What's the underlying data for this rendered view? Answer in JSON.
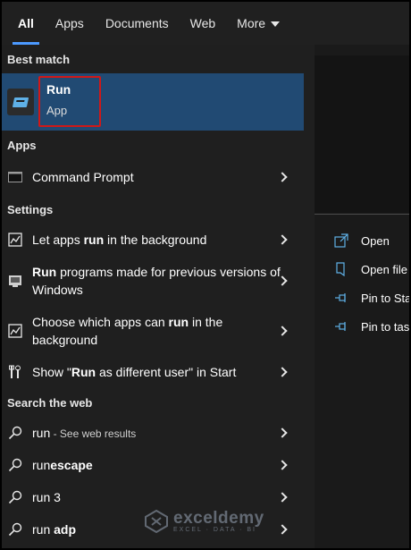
{
  "tabs": [
    {
      "label": "All",
      "active": true
    },
    {
      "label": "Apps"
    },
    {
      "label": "Documents"
    },
    {
      "label": "Web"
    },
    {
      "label": "More"
    }
  ],
  "best_match": {
    "header": "Best match",
    "title": "Run",
    "subtitle": "App",
    "icon": "run-app-icon",
    "highlight_color": "#d01818"
  },
  "apps": {
    "header": "Apps",
    "items": [
      {
        "label": "Command Prompt",
        "icon": "command-prompt-icon"
      }
    ]
  },
  "settings": {
    "header": "Settings",
    "items": [
      {
        "pre": "Let apps ",
        "bold": "run",
        "post": " in the background",
        "icon": "chart-settings-icon"
      },
      {
        "pre": "",
        "bold": "Run",
        "post": " programs made for previous versions of Windows",
        "icon": "compat-settings-icon"
      },
      {
        "pre": "Choose which apps can ",
        "bold": "run",
        "post": " in the background",
        "icon": "chart-settings-icon"
      },
      {
        "pre": "Show \"",
        "bold": "Run",
        "post": " as different user\" in Start",
        "icon": "tools-settings-icon"
      }
    ]
  },
  "web": {
    "header": "Search the web",
    "items": [
      {
        "pre": "run",
        "bold": "",
        "muted": " - See web results"
      },
      {
        "pre": "run",
        "bold": "escape",
        "muted": ""
      },
      {
        "pre": "run 3",
        "bold": "",
        "muted": ""
      },
      {
        "pre": "run ",
        "bold": "adp",
        "muted": ""
      }
    ]
  },
  "actions": [
    {
      "label": "Open",
      "icon": "open-icon"
    },
    {
      "label": "Open file",
      "icon": "open-file-location-icon"
    },
    {
      "label": "Pin to Star",
      "icon": "pin-icon"
    },
    {
      "label": "Pin to task",
      "icon": "pin-icon"
    }
  ],
  "watermark": {
    "name": "exceldemy",
    "tagline": "EXCEL · DATA · BI"
  },
  "colors": {
    "accent": "#4c9aff",
    "selected_row": "#214a73",
    "background": "#1f1f1f"
  }
}
